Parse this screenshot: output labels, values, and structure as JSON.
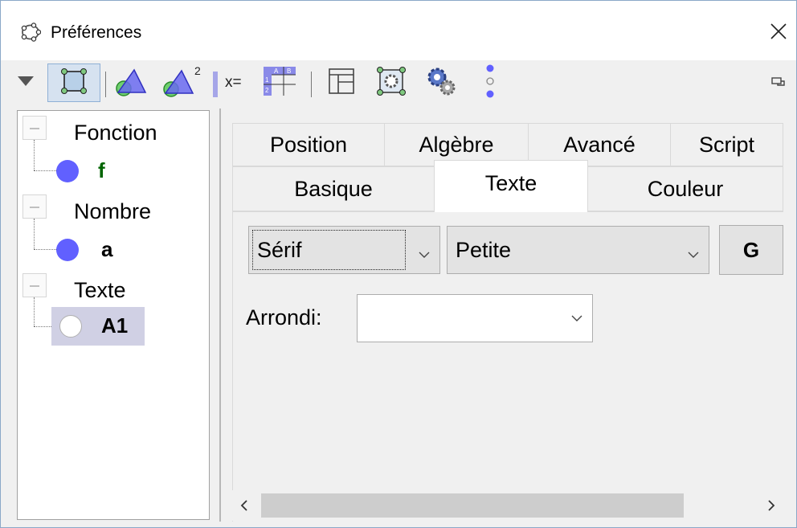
{
  "window": {
    "title": "Préférences",
    "icon": "geogebra-logo-icon",
    "close_icon": "close-icon"
  },
  "toolbar": {
    "items": [
      "menu-arrow-icon",
      "graphics-icon",
      "graphics-3d-icon",
      "graphics-2-icon",
      "algebra-icon",
      "spreadsheet-icon",
      "layout-icon",
      "defaults-icon",
      "advanced-settings-icon",
      "more-icon"
    ],
    "restore_icon": "restore-window-icon"
  },
  "tree": {
    "groups": [
      {
        "label": "Fonction",
        "items": [
          {
            "label": "f",
            "color": "#6160ff",
            "text_color": "#006400"
          }
        ]
      },
      {
        "label": "Nombre",
        "items": [
          {
            "label": "a",
            "color": "#6160ff",
            "text_color": "#000000"
          }
        ]
      },
      {
        "label": "Texte",
        "items": [
          {
            "label": "A1",
            "color": "#ffffff",
            "text_color": "#000000",
            "selected": true
          }
        ]
      }
    ]
  },
  "tabs": {
    "row1": [
      "Position",
      "Algèbre",
      "Avancé",
      "Script"
    ],
    "row2": [
      "Basique",
      "Texte",
      "Couleur"
    ],
    "active": "Texte"
  },
  "texte": {
    "font_family": "Sérif",
    "font_size": "Petite",
    "bold_label": "G",
    "rounding_label": "Arrondi:",
    "rounding_value": ""
  },
  "colors": {
    "accent": "#6160ff",
    "selection": "#d0d0e4",
    "tree_dot": "#6160ff"
  }
}
